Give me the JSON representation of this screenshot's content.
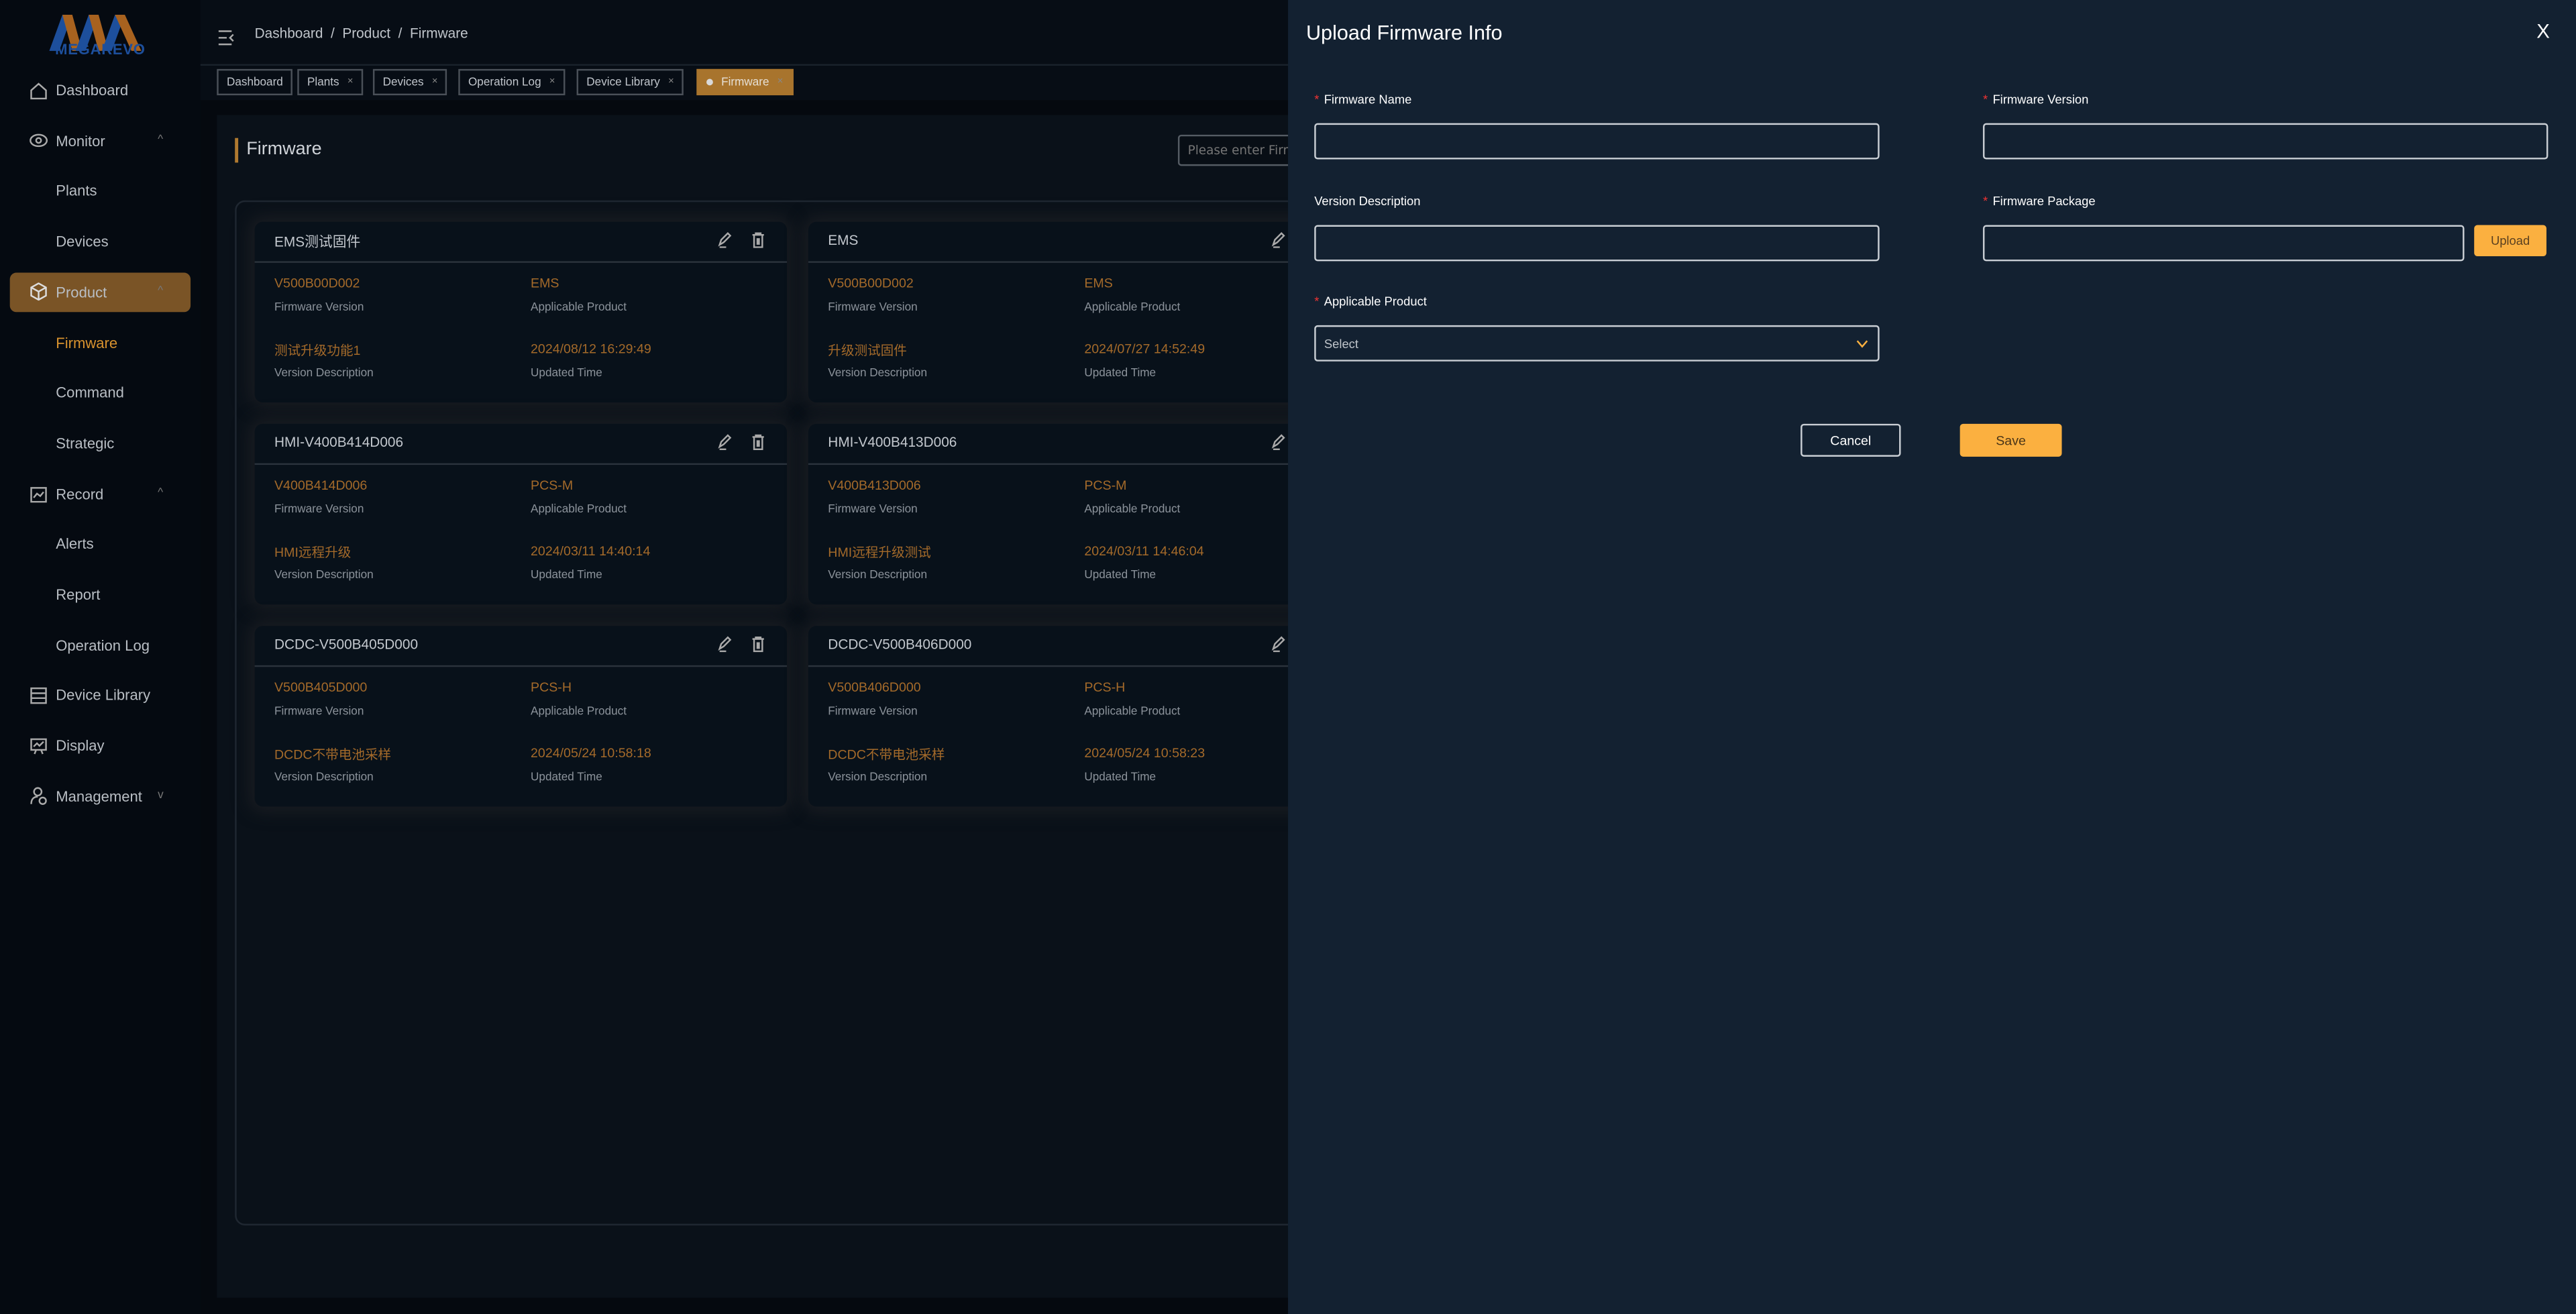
{
  "brand": {
    "name": "MEGAREVO",
    "colors": {
      "accent": "#fbb040",
      "active_menu": "#7a5426",
      "value_text": "#a46a2a",
      "drawer_bg": "#132131"
    }
  },
  "sidebar": {
    "items": [
      {
        "label": "Dashboard",
        "icon": "home-icon"
      },
      {
        "label": "Monitor",
        "icon": "eye-icon",
        "chevron": "^"
      },
      {
        "label": "Plants"
      },
      {
        "label": "Devices"
      },
      {
        "label": "Product",
        "icon": "cube-icon",
        "chevron": "^",
        "active": true
      },
      {
        "label": "Firmware",
        "selected": true
      },
      {
        "label": "Command"
      },
      {
        "label": "Strategic"
      },
      {
        "label": "Record",
        "icon": "clipboard-chart-icon",
        "chevron": "^"
      },
      {
        "label": "Alerts"
      },
      {
        "label": "Report"
      },
      {
        "label": "Operation Log"
      },
      {
        "label": "Device Library",
        "icon": "server-icon"
      },
      {
        "label": "Display",
        "icon": "presentation-icon"
      },
      {
        "label": "Management",
        "icon": "user-settings-icon",
        "chevron": "v"
      }
    ]
  },
  "breadcrumb": "Dashboard  /  Product  /  Firmware",
  "tabs": [
    {
      "label": "Dashboard"
    },
    {
      "label": "Plants",
      "x": "×"
    },
    {
      "label": "Devices",
      "x": "×"
    },
    {
      "label": "Operation Log",
      "x": "×"
    },
    {
      "label": "Device Library",
      "x": "×"
    },
    {
      "label": "Firmware",
      "x": "×",
      "active": true
    }
  ],
  "page": {
    "title": "Firmware",
    "search_placeholder": "Please enter Firmware Name"
  },
  "labels": {
    "version": "Firmware Version",
    "product": "Applicable Product",
    "desc": "Version Description",
    "time": "Updated Time"
  },
  "cards": [
    {
      "name": "EMS测试固件",
      "version": "V500B00D002",
      "product": "EMS",
      "desc": "测试升级功能1",
      "time": "2024/08/12 16:29:49"
    },
    {
      "name": "EMS",
      "version": "V500B00D002",
      "product": "EMS",
      "desc": "升级测试固件",
      "time": "2024/07/27 14:52:49"
    },
    {
      "name": "HMI-V400B414D006",
      "version": "V400B414D006",
      "product": "PCS-M",
      "desc": "HMI远程升级",
      "time": "2024/03/11 14:40:14"
    },
    {
      "name": "HMI-V400B413D006",
      "version": "V400B413D006",
      "product": "PCS-M",
      "desc": "HMI远程升级测试",
      "time": "2024/03/11 14:46:04"
    },
    {
      "name": "DCDC-V500B405D000",
      "version": "V500B405D000",
      "product": "PCS-H",
      "desc": "DCDC不带电池采样",
      "time": "2024/05/24 10:58:18"
    },
    {
      "name": "DCDC-V500B406D000",
      "version": "V500B406D000",
      "product": "PCS-H",
      "desc": "DCDC不带电池采样",
      "time": "2024/05/24 10:58:23"
    }
  ],
  "drawer": {
    "title": "Upload Firmware Info",
    "close": "X",
    "fields": {
      "name": {
        "label": "Firmware Name",
        "value": ""
      },
      "version": {
        "label": "Firmware Version",
        "value": ""
      },
      "desc": {
        "label": "Version Description",
        "value": ""
      },
      "package": {
        "label": "Firmware Package",
        "value": ""
      },
      "product": {
        "label": "Applicable Product",
        "placeholder": "Select"
      }
    },
    "required": "*",
    "upload": "Upload",
    "cancel": "Cancel",
    "save": "Save"
  }
}
